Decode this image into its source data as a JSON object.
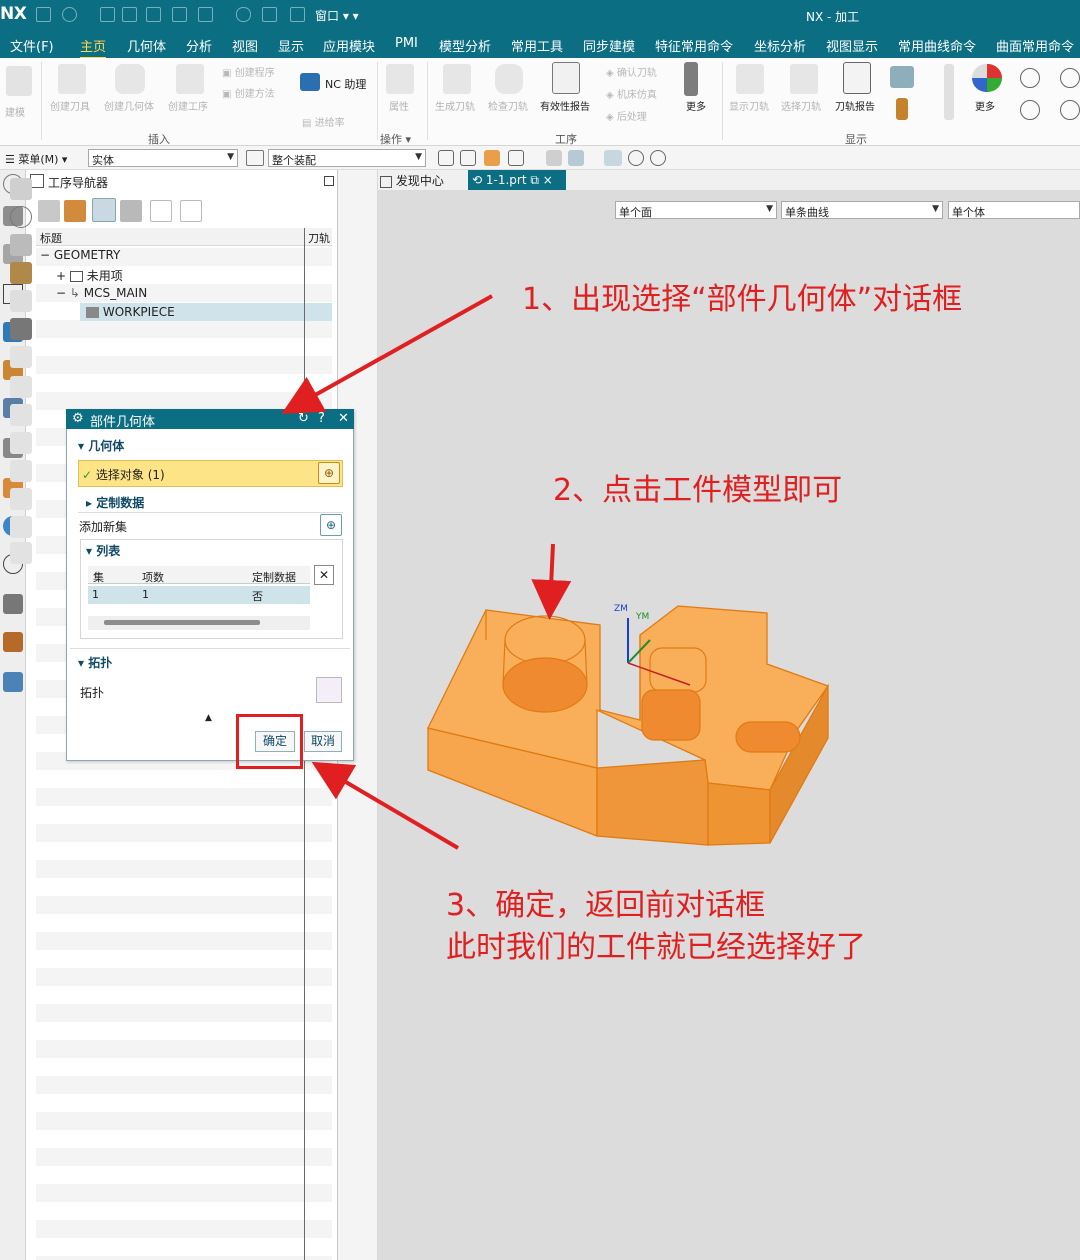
{
  "app": {
    "logo": "NX",
    "window_menu": "窗口",
    "title": "NX - 加工"
  },
  "menubar": {
    "items": [
      "文件(F)",
      "主页",
      "几何体",
      "分析",
      "视图",
      "显示",
      "应用模块",
      "PMI",
      "模型分析",
      "常用工具",
      "同步建模",
      "特征常用命令",
      "坐标分析",
      "视图显示",
      "常用曲线命令",
      "曲面常用命令"
    ],
    "active": "主页"
  },
  "ribbon": {
    "build": "建模",
    "create_tool": "创建刀具",
    "create_geometry": "创建几何体",
    "create_operation": "创建工序",
    "create_program": "创建程序",
    "create_method": "创建方法",
    "nc_assistant": "NC 助理",
    "feed_rate": "进给率",
    "properties": "属性",
    "generate_toolpath": "生成刀轨",
    "verify_toolpath": "检查刀轨",
    "validity_report": "有效性报告",
    "confirm_toolpath": "确认刀轨",
    "machine_sim": "机床仿真",
    "postprocess": "后处理",
    "more_1": "更多",
    "display_toolpath": "显示刀轨",
    "select_toolpath": "选择刀轨",
    "toolpath_report": "刀轨报告",
    "more_2": "更多",
    "group_insert": "插入",
    "group_operation": "操作",
    "group_process": "工序",
    "group_display": "显示"
  },
  "filterbar": {
    "menu": "菜单(M)",
    "type_filter": "实体",
    "scope": "整个装配"
  },
  "navigator": {
    "title": "工序导航器",
    "col_title": "标题",
    "col_tool": "刀轨",
    "tree": [
      "GEOMETRY",
      "未用项",
      "MCS_MAIN",
      "WORKPIECE"
    ]
  },
  "tabs": {
    "discover": "发现中心",
    "part": "1-1.prt"
  },
  "selection_bar": {
    "face_rule": "单个面",
    "curve_rule": "单条曲线",
    "body_rule": "单个体"
  },
  "dialog": {
    "title": "部件几何体",
    "section_geometry": "几何体",
    "select_object": "选择对象 (1)",
    "custom_data": "定制数据",
    "add_new_set": "添加新集",
    "section_list": "列表",
    "table_headers": [
      "集",
      "项数",
      "定制数据"
    ],
    "table_row": [
      "1",
      "1",
      "否"
    ],
    "section_topology": "拓扑",
    "topology_label": "拓扑",
    "ok": "确定",
    "cancel": "取消"
  },
  "viewport": {
    "axis_z": "ZM",
    "axis_y": "YM"
  },
  "annotations": {
    "step1": "1、出现选择“部件几何体”对话框",
    "step2": "2、点击工件模型即可",
    "step3_line1": "3、确定，返回前对话框",
    "step3_line2": "此时我们的工件就已经选择好了"
  },
  "colors": {
    "teal": "#0b6e82",
    "model_orange": "#f7a64d",
    "annotation_red": "#e02020",
    "highlight_yellow": "#fde486"
  }
}
